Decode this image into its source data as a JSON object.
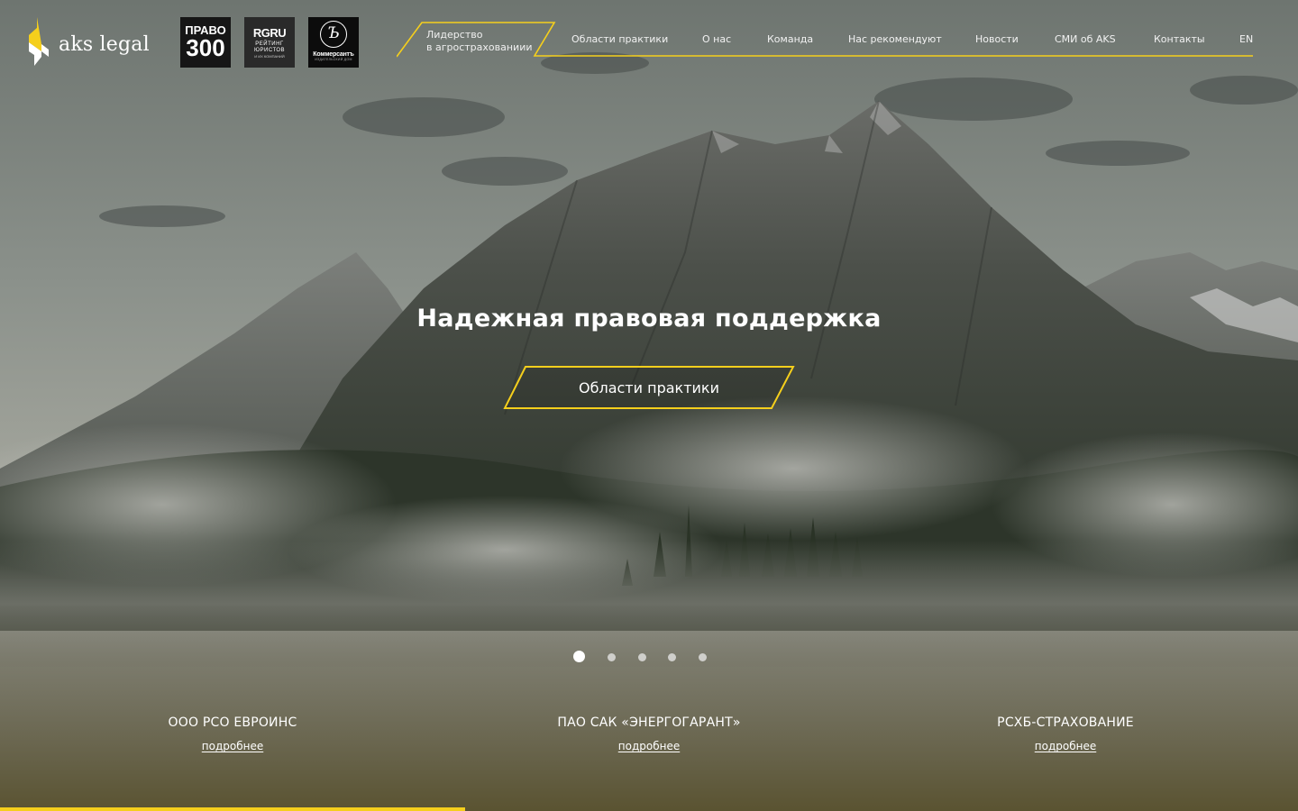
{
  "brand": {
    "name": "aks legal",
    "accent_color": "#f5cf1c"
  },
  "badges": {
    "pravo": {
      "line1": "ПРАВО",
      "line2": "300"
    },
    "rgru": {
      "line1": "RGRU",
      "line2": "РЕЙТИНГ\nЮРИСТОВ",
      "line3": "И ИХ КОМПАНИЙ"
    },
    "kommersant": {
      "mark": "Ъ",
      "line1": "Коммерсантъ",
      "line2": "ИЗДАТЕЛЬСКИЙ ДОМ"
    }
  },
  "header": {
    "leadership_line1": "Лидерство",
    "leadership_line2": "в агрострахованиии",
    "nav": [
      {
        "label": "Области практики"
      },
      {
        "label": "О нас"
      },
      {
        "label": "Команда"
      },
      {
        "label": "Нас рекомендуют"
      },
      {
        "label": "Новости"
      },
      {
        "label": "СМИ об AKS"
      },
      {
        "label": "Контакты"
      },
      {
        "label": "EN"
      }
    ]
  },
  "hero": {
    "title": "Надежная правовая поддержка",
    "cta_label": "Области практики",
    "slides_total": 5,
    "active_slide": 1
  },
  "clients": [
    {
      "name": "ООО РСО ЕВРОИНС",
      "more": "подробнее"
    },
    {
      "name": "ПАО САК «ЭНЕРГОГАРАНТ»",
      "more": "подробнее"
    },
    {
      "name": "РСХБ-СТРАХОВАНИЕ",
      "more": "подробнее"
    }
  ],
  "slide_progress_fraction": 0.358
}
